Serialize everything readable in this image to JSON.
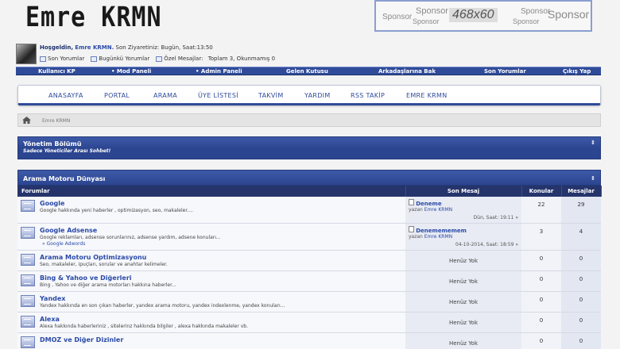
{
  "header": {
    "logo": "Emre KRMN",
    "sponsor": [
      "Sponsor",
      "Sponsor",
      "Sponsor",
      "468x60",
      "Sponsor",
      "Sponsor",
      "Sponsor"
    ]
  },
  "user": {
    "welcome": "Hoşgeldin,",
    "name": "Emre KRMN.",
    "last_visit": "Son Ziyaretiniz: Bugün, Saat:13:50",
    "links": [
      "Son Yorumlar",
      "Bugünkü Yorumlar",
      "Özel Mesajlar:",
      "Toplam 3, Okunmamış 0"
    ]
  },
  "topbar": [
    "Kullanıcı KP",
    "• Mod Paneli",
    "• Admin Paneli",
    "Gelen Kutusu",
    "Arkadaşlarına Bak",
    "Son Yorumlar",
    "Çıkış Yap"
  ],
  "menu": [
    "ANASAYFA",
    "PORTAL",
    "ARAMA",
    "ÜYE LİSTESİ",
    "TAKVİM",
    "YARDIM",
    "RSS TAKİP",
    "EMRE KRMN"
  ],
  "breadcrumb": "Emre KRMN",
  "admin_section": {
    "title": "Yönetim Bölümü",
    "subtitle": "Sadece Yöneticiler Arası Sohbet!",
    "arrow": "⇕"
  },
  "search_section": {
    "title": "Arama Motoru Dünyası",
    "arrow": "⇕",
    "columns": [
      "Forumlar",
      "Son Mesaj",
      "Konular",
      "Mesajlar"
    ],
    "forums": [
      {
        "title": "Google",
        "desc": "Google hakkında yeni haberler , optimizasyon, seo, makaleler....",
        "sub": "",
        "last_title": "Deneme",
        "last_by_prefix": "yazan",
        "last_by": "Emre KRMN",
        "last_date": "Dün, Saat: 19:11 »",
        "topics": "22",
        "posts": "29"
      },
      {
        "title": "Google Adsense",
        "desc": "Google reklamları, adsense sorunlarınız, adsense yardım, adsene konuları...",
        "sub": "Google Adwords",
        "last_title": "Denemememem",
        "last_by_prefix": "yazan",
        "last_by": "Emre KRMN",
        "last_date": "04-10-2014, Saat: 18:59 »",
        "topics": "3",
        "posts": "4"
      },
      {
        "title": "Arama Motoru Optimizasyonu",
        "desc": "Seo, makaleler, ipuçları, sorular ve anahtar kelimeler.",
        "sub": "",
        "none": "Henüz Yok",
        "topics": "0",
        "posts": "0"
      },
      {
        "title": "Bing & Yahoo ve Diğerleri",
        "desc": "Bing , Yahoo ve diğer arama motorları hakkına haberler...",
        "sub": "",
        "none": "Henüz Yok",
        "topics": "0",
        "posts": "0"
      },
      {
        "title": "Yandex",
        "desc": "Yandex hakkında en son çıkan haberler, yandex arama motoru, yandex indexlenme, yandex konuları...",
        "sub": "",
        "none": "Henüz Yok",
        "topics": "0",
        "posts": "0"
      },
      {
        "title": "Alexa",
        "desc": "Alexa hakkında haberleriniz , sitelerinz hakkında bilgiler , alexa hakkında makaleler vb.",
        "sub": "",
        "none": "Henüz Yok",
        "topics": "0",
        "posts": "0"
      },
      {
        "title": "DMOZ ve Diğer Dizinler",
        "desc": "",
        "sub": "",
        "none": "Henüz Yok",
        "topics": "0",
        "posts": "0"
      }
    ]
  }
}
